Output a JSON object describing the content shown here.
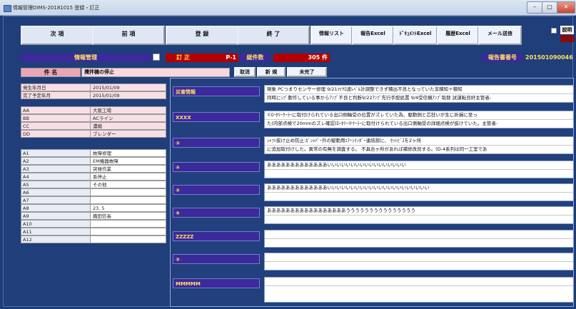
{
  "window": {
    "title": "情報管理DIMS-20181015 登録・訂正",
    "min": "–",
    "max": "□",
    "close": "✕"
  },
  "toolbar": {
    "next": "次 項",
    "prev": "前 項",
    "register": "登 録",
    "exit": "終 了",
    "info_list": "情報リスト",
    "report_excel": "報告Excel",
    "doc_excel": "ﾄﾞｷｭﾒﾝﾄExcel",
    "history_excel": "履歴Excel",
    "mail_send": "メール送信",
    "explain": "説明"
  },
  "header": {
    "info_mgmt": "情報管理",
    "correction": "訂 正",
    "page": "P-1",
    "total_label": "総件数",
    "total_count": "305 件",
    "report_no_label": "報告書番号",
    "report_no": "201501090046",
    "subject_label": "件 名",
    "subject": "攪拌機の停止",
    "cancel": "取消",
    "new": "新 規",
    "status": "未完了"
  },
  "dates": [
    {
      "label": "発生年月日",
      "value": "2015/01/09"
    },
    {
      "label": "完了予定年月",
      "value": "2015/01/09"
    }
  ],
  "orgs": [
    {
      "label": "AA",
      "value": "大阪工場"
    },
    {
      "label": "BB",
      "value": "ACライン"
    },
    {
      "label": "CC",
      "value": "濃縮"
    },
    {
      "label": "DD",
      "value": "ブレンダー"
    }
  ],
  "attrs": [
    {
      "label": "A1",
      "value": "故障修理"
    },
    {
      "label": "A2",
      "value": "EM機器故障"
    },
    {
      "label": "A3",
      "value": "突発作業"
    },
    {
      "label": "A4",
      "value": "系停止"
    },
    {
      "label": "A5",
      "value": "その他"
    },
    {
      "label": "A6",
      "value": ""
    },
    {
      "label": "A7",
      "value": ""
    },
    {
      "label": "A8",
      "value": "23. 5"
    },
    {
      "label": "A9",
      "value": "織田信長"
    },
    {
      "label": "A10",
      "value": ""
    },
    {
      "label": "A11",
      "value": ""
    },
    {
      "label": "A12",
      "value": ""
    }
  ],
  "sections": [
    {
      "label": "災害情報",
      "lines": [
        "現象 PCつまりセンサー修理 9/21ﾏｲｸﾛ波ﾚﾍﾞﾙ計調整できず積出不良となっていた非積知＋積知",
        "同時にｼﾌﾞ動作している事からｱﾝﾌﾟ不良と判断9/22ｱﾝﾌﾟ先行手配処置 9/4受信機ｱﾝﾌﾟ取替 試運転良好主管者-"
      ]
    },
    {
      "label": "XXXX",
      "lines": [
        "①ﾛｰﾀﾘｰｸｰﾗｰに取付けられている出口側軸受の位置がズレていた為、駆動側と芯狂いが生じ折損に至っ",
        "た(内部点検で20mmのズレ確認)ﾛｰﾀﾘｰ②ｸｰﾗｰに取付けられている出口側軸受の詳細点検が抜けていた。主管者-"
      ]
    },
    {
      "label": "③",
      "lines": [
        "ｼｬﾌﾄ抜け止め防止:ｶﾞｼｬﾊﾟｰ外の駆動用ｴｱｰｼﾘﾝﾀﾞｰ連結部に、 ｾｯﾄﾋﾞｽを2ヶ所",
        "に追加取付けした。異常の有無を調査する。 不具合ヶ所があれば補修改良する。(D-4系列は同一工室であ"
      ]
    },
    {
      "label": "④",
      "lines": [
        "あああああああああああああいいいいいいいいいいいいいいいいい",
        ""
      ]
    },
    {
      "label": "⑤",
      "lines": [
        "あああああああああああああいいいいいいいいいいいいいいいいいいいいいい",
        ""
      ]
    },
    {
      "label": "⑥",
      "lines": [
        "あああああああああああああああああううううううううううううううう",
        ""
      ]
    },
    {
      "label": "ZZZZZ",
      "lines": [
        "",
        ""
      ]
    },
    {
      "label": "⑤",
      "lines": [
        "",
        ""
      ]
    },
    {
      "label": "MMMMM",
      "lines": [
        "",
        ""
      ]
    }
  ],
  "colors": {
    "background": "#1d3d78",
    "label_purple": "#3b2a9a",
    "label_red": "#b40000",
    "label_yellow": "#ffe060",
    "pink": "#f8d8e0"
  }
}
